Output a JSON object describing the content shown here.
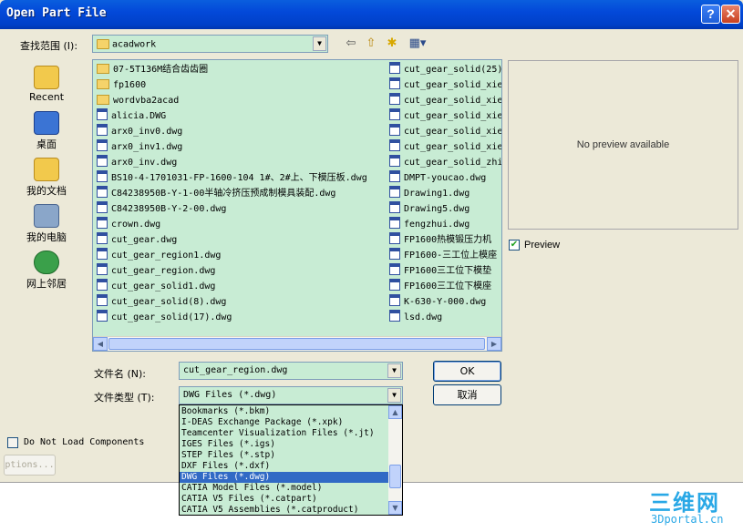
{
  "window": {
    "title": "Open Part File",
    "help_glyph": "?",
    "close_glyph": "✕"
  },
  "lookin": {
    "label": "查找范围 (I):",
    "value": "acadwork"
  },
  "places": [
    {
      "label": "Recent",
      "icon": "recent-icon",
      "color": "#f2c94c"
    },
    {
      "label": "桌面",
      "icon": "desktop-icon",
      "color": "#3b74d4"
    },
    {
      "label": "我的文档",
      "icon": "my-documents-icon",
      "color": "#f2c94c"
    },
    {
      "label": "我的电脑",
      "icon": "my-computer-icon",
      "color": "#8aa6c9"
    },
    {
      "label": "网上邻居",
      "icon": "network-icon",
      "color": "#3aa04a"
    }
  ],
  "files_col1": [
    {
      "name": "07-5T136M结合齿齿圈",
      "kind": "dir"
    },
    {
      "name": "fp1600",
      "kind": "dir"
    },
    {
      "name": "wordvba2acad",
      "kind": "dir"
    },
    {
      "name": "alicia.DWG",
      "kind": "dwg"
    },
    {
      "name": "arx0_inv0.dwg",
      "kind": "dwg"
    },
    {
      "name": "arx0_inv1.dwg",
      "kind": "dwg"
    },
    {
      "name": "arx0_inv.dwg",
      "kind": "dwg"
    },
    {
      "name": "BS10-4-1701031-FP-1600-104 1#、2#上、下模压板.dwg",
      "kind": "dwg"
    },
    {
      "name": "C84238950B-Y-1-00半轴冷挤压预成制模具装配.dwg",
      "kind": "dwg"
    },
    {
      "name": "C84238950B-Y-2-00.dwg",
      "kind": "dwg"
    },
    {
      "name": "crown.dwg",
      "kind": "dwg"
    },
    {
      "name": "cut_gear.dwg",
      "kind": "dwg"
    },
    {
      "name": "cut_gear_region1.dwg",
      "kind": "dwg"
    },
    {
      "name": "cut_gear_region.dwg",
      "kind": "dwg"
    },
    {
      "name": "cut_gear_solid1.dwg",
      "kind": "dwg"
    },
    {
      "name": "cut_gear_solid(8).dwg",
      "kind": "dwg"
    },
    {
      "name": "cut_gear_solid(17).dwg",
      "kind": "dwg"
    }
  ],
  "files_col2": [
    {
      "name": "cut_gear_solid(25)",
      "kind": "dwg"
    },
    {
      "name": "cut_gear_solid_xie",
      "kind": "dwg"
    },
    {
      "name": "cut_gear_solid_xie",
      "kind": "dwg"
    },
    {
      "name": "cut_gear_solid_xie",
      "kind": "dwg"
    },
    {
      "name": "cut_gear_solid_xie",
      "kind": "dwg"
    },
    {
      "name": "cut_gear_solid_xie",
      "kind": "dwg"
    },
    {
      "name": "cut_gear_solid_zhi",
      "kind": "dwg"
    },
    {
      "name": "DMPT-youcao.dwg",
      "kind": "dwg"
    },
    {
      "name": "Drawing1.dwg",
      "kind": "dwg"
    },
    {
      "name": "Drawing5.dwg",
      "kind": "dwg"
    },
    {
      "name": "fengzhui.dwg",
      "kind": "dwg"
    },
    {
      "name": "FP1600热模锻压力机",
      "kind": "dwg"
    },
    {
      "name": "FP1600-三工位上模座",
      "kind": "dwg"
    },
    {
      "name": "FP1600三工位下模垫",
      "kind": "dwg"
    },
    {
      "name": "FP1600三工位下模座",
      "kind": "dwg"
    },
    {
      "name": "K-630-Y-000.dwg",
      "kind": "dwg"
    },
    {
      "name": "lsd.dwg",
      "kind": "dwg"
    }
  ],
  "preview": {
    "message": "No preview available",
    "checkbox_label": "Preview",
    "checked": true
  },
  "filename": {
    "label": "文件名 (N):",
    "value": "cut_gear_region.dwg"
  },
  "filetype": {
    "label": "文件类型 (T):",
    "value": "DWG Files (*.dwg)"
  },
  "buttons": {
    "ok": "OK",
    "cancel": "取消",
    "options": "ptions..."
  },
  "no_components": {
    "label": "Do Not Load Components",
    "checked": false
  },
  "filetype_options": [
    {
      "label": "Bookmarks (*.bkm)",
      "selected": false
    },
    {
      "label": "I-DEAS Exchange Package (*.xpk)",
      "selected": false
    },
    {
      "label": "Teamcenter Visualization Files (*.jt)",
      "selected": false
    },
    {
      "label": "IGES Files (*.igs)",
      "selected": false
    },
    {
      "label": "STEP Files (*.stp)",
      "selected": false
    },
    {
      "label": "DXF Files (*.dxf)",
      "selected": false
    },
    {
      "label": "DWG Files (*.dwg)",
      "selected": true
    },
    {
      "label": "CATIA Model Files (*.model)",
      "selected": false
    },
    {
      "label": "CATIA V5 Files (*.catpart)",
      "selected": false
    },
    {
      "label": "CATIA V5 Assemblies (*.catproduct)",
      "selected": false
    }
  ],
  "dropdown_scroll": {
    "position": 0.78
  },
  "watermark": {
    "line1": "三维网",
    "line2": "3Dportal.cn"
  }
}
